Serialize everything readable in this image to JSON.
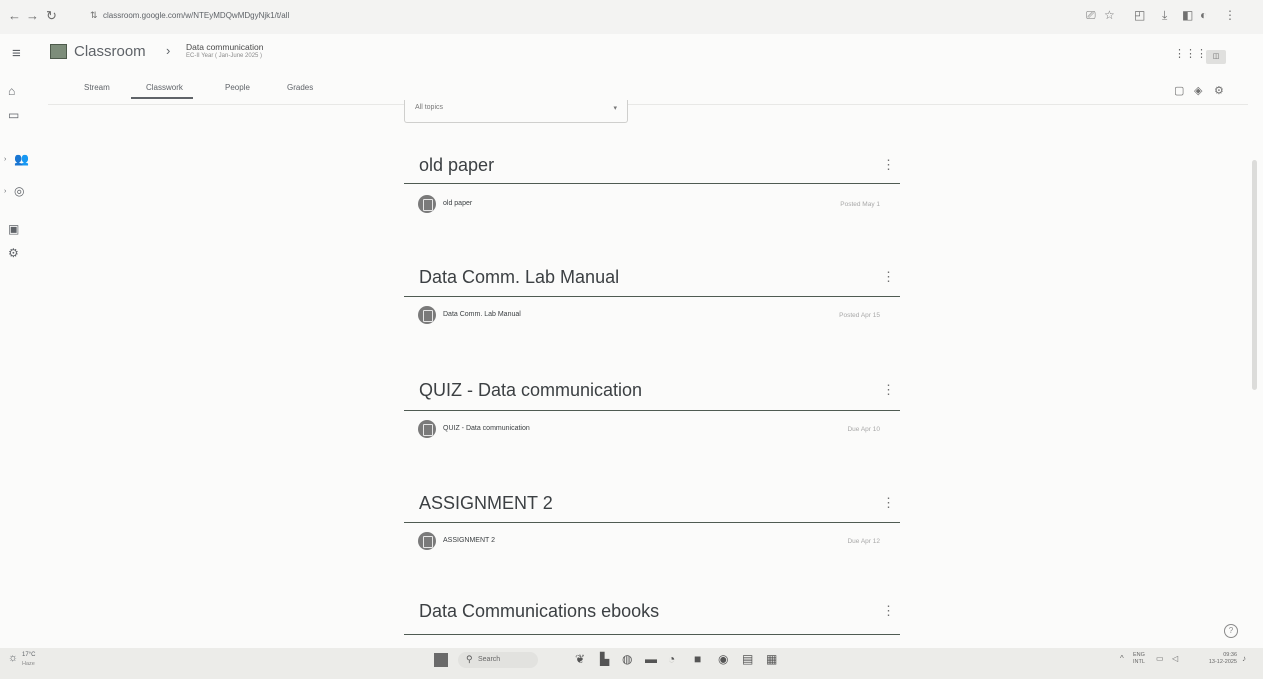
{
  "browser": {
    "url": "classroom.google.com/w/NTEyMDQwMDgyNjk1/t/all"
  },
  "header": {
    "app_title": "Classroom",
    "class_name": "Data communication",
    "class_subtitle": "EC-II Year ( Jan-June 2025 )"
  },
  "tabs": [
    {
      "label": "Stream"
    },
    {
      "label": "Classwork"
    },
    {
      "label": "People"
    },
    {
      "label": "Grades"
    }
  ],
  "active_tab": "Classwork",
  "topic_filter": {
    "label": "All topics"
  },
  "topics": [
    {
      "title": "old paper",
      "item": {
        "label": "old paper",
        "date": "Posted May 1",
        "icon": "material-icon"
      }
    },
    {
      "title": "Data Comm. Lab Manual",
      "item": {
        "label": "Data Comm. Lab Manual",
        "date": "Posted Apr 15",
        "icon": "material-icon"
      }
    },
    {
      "title": "QUIZ - Data communication",
      "item": {
        "label": "QUIZ - Data communication",
        "date": "Due Apr 10",
        "icon": "assignment-icon"
      }
    },
    {
      "title": "ASSIGNMENT 2",
      "item": {
        "label": "ASSIGNMENT 2",
        "date": "Due Apr 12",
        "icon": "assignment-icon"
      }
    },
    {
      "title": "Data Communications ebooks"
    }
  ],
  "taskbar": {
    "weather_temp": "17°C",
    "weather_desc": "Haze",
    "search_label": "Search",
    "lang_1": "ENG",
    "lang_2": "INTL",
    "time": "09:36",
    "date": "13-12-2025"
  }
}
